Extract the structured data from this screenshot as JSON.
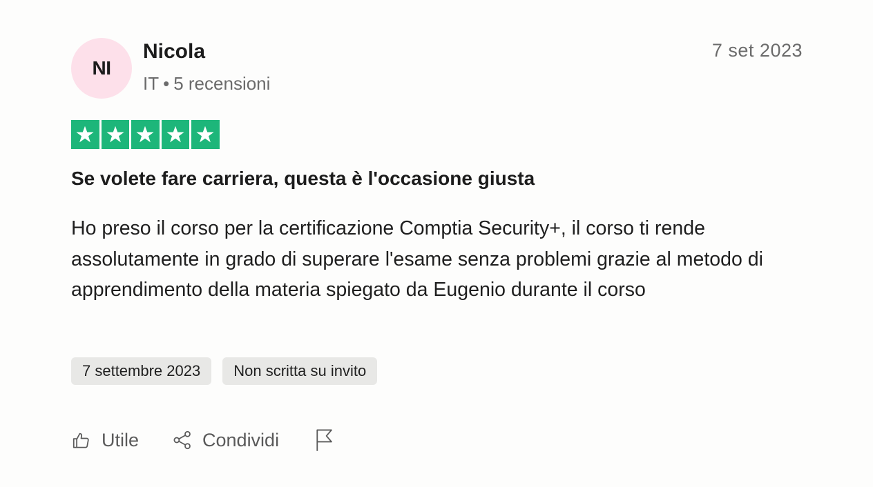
{
  "reviewer": {
    "initials": "NI",
    "name": "Nicola",
    "country": "IT",
    "reviews_count": "5 recensioni",
    "avatar_color": "#fde0ea"
  },
  "review": {
    "date_short": "7 set 2023",
    "rating": 5,
    "rating_max": 5,
    "star_color": "#1db67a",
    "title": "Se volete fare carriera, questa è l'occasione giusta",
    "body": "Ho preso il corso per la certificazione Comptia Security+, il corso ti rende assolutamente in grado di superare l'esame senza problemi grazie al metodo di apprendimento della materia spiegato da Eugenio durante il corso",
    "tags": [
      "7 settembre 2023",
      "Non scritta su invito"
    ]
  },
  "actions": {
    "useful_label": "Utile",
    "useful_icon": "thumbs-up-icon",
    "share_label": "Condividi",
    "share_icon": "share-icon",
    "report_icon": "flag-icon"
  }
}
